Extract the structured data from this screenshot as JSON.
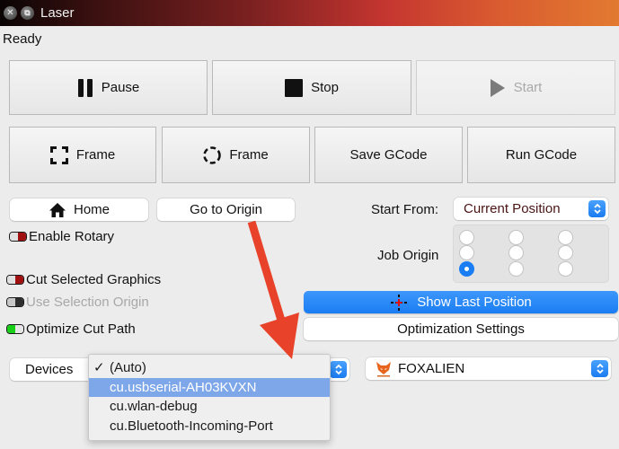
{
  "window": {
    "title": "Laser",
    "close_icon": "close-icon",
    "restore_icon": "restore-icon"
  },
  "status": "Ready",
  "controls": {
    "pause": {
      "label": "Pause",
      "icon": "pause-icon"
    },
    "stop": {
      "label": "Stop",
      "icon": "stop-icon"
    },
    "start": {
      "label": "Start",
      "icon": "play-icon",
      "enabled": false
    },
    "frame_rect": {
      "label": "Frame",
      "icon": "frame-rectangle-icon"
    },
    "frame_circle": {
      "label": "Frame",
      "icon": "frame-circle-icon"
    },
    "save_gcode": {
      "label": "Save GCode"
    },
    "run_gcode": {
      "label": "Run GCode"
    }
  },
  "home": {
    "label": "Home",
    "icon": "home-icon"
  },
  "go_to_origin": {
    "label": "Go to Origin"
  },
  "start_from": {
    "label": "Start From:",
    "selected": "Current Position"
  },
  "job_origin": {
    "label": "Job Origin",
    "selected": {
      "row": 3,
      "col": 1
    }
  },
  "options": {
    "enable_rotary": {
      "label": "Enable Rotary",
      "on": false,
      "enabled": true
    },
    "cut_selected_graphics": {
      "label": "Cut Selected Graphics",
      "on": false,
      "enabled": true
    },
    "use_selection_origin": {
      "label": "Use Selection Origin",
      "on": false,
      "enabled": false
    },
    "optimize_cut_path": {
      "label": "Optimize Cut Path",
      "on": true,
      "enabled": true
    }
  },
  "show_last_position": {
    "label": "Show Last Position",
    "icon": "crosshair-icon"
  },
  "optimization_settings": {
    "label": "Optimization Settings"
  },
  "devices": {
    "label": "Devices",
    "menu": [
      {
        "label": "(Auto)",
        "checked": true,
        "highlighted": false
      },
      {
        "label": "cu.usbserial-AH03KVXN",
        "checked": false,
        "highlighted": true
      },
      {
        "label": "cu.wlan-debug",
        "checked": false,
        "highlighted": false
      },
      {
        "label": "cu.Bluetooth-Incoming-Port",
        "checked": false,
        "highlighted": false
      }
    ],
    "check_mark": "✓"
  },
  "machine": {
    "selected": "FOXALIEN",
    "icon": "foxalien-logo-icon"
  },
  "colors": {
    "accent_blue": "#1a7df3",
    "toggle_off_red": "#a01010",
    "toggle_on_green": "#18d018",
    "annotation_arrow": "#e8432a",
    "menu_highlight": "#7ea7e9"
  }
}
